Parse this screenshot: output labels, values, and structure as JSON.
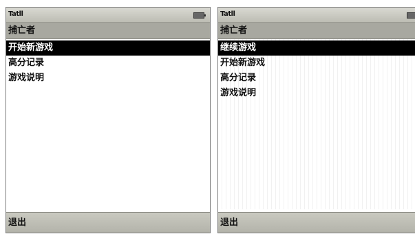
{
  "left_phone": {
    "status": {
      "signal_text": "Tatll"
    },
    "title": "捕亡者",
    "menu": [
      {
        "label": "开始新游戏",
        "selected": true
      },
      {
        "label": "高分记录",
        "selected": false
      },
      {
        "label": "游戏说明",
        "selected": false
      }
    ],
    "soft_key": "退出"
  },
  "right_phone": {
    "status": {
      "signal_text": "Tatll"
    },
    "title": "捕亡者",
    "menu": [
      {
        "label": "继续游戏",
        "selected": true
      },
      {
        "label": "开始新游戏",
        "selected": false
      },
      {
        "label": "高分记录",
        "selected": false
      },
      {
        "label": "游戏说明",
        "selected": false
      }
    ],
    "soft_key": "退出"
  }
}
